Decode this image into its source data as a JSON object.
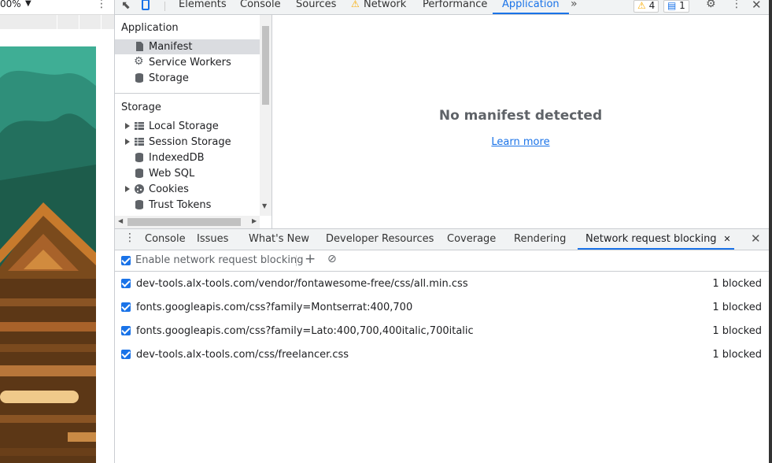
{
  "viewport": {
    "zoom_label": "00%"
  },
  "toolbar": {
    "tabs": [
      "Elements",
      "Console",
      "Sources",
      "Network",
      "Performance",
      "Application"
    ],
    "active_tab": "Application",
    "warnings_count": "4",
    "messages_count": "1"
  },
  "sidebar": {
    "application_heading": "Application",
    "application_items": [
      "Manifest",
      "Service Workers",
      "Storage"
    ],
    "storage_heading": "Storage",
    "storage_items": [
      "Local Storage",
      "Session Storage",
      "IndexedDB",
      "Web SQL",
      "Cookies",
      "Trust Tokens"
    ]
  },
  "main": {
    "title": "No manifest detected",
    "link": "Learn more"
  },
  "drawer": {
    "tabs": [
      "Console",
      "Issues",
      "What's New",
      "Developer Resources",
      "Coverage",
      "Rendering",
      "Network request blocking"
    ],
    "active_tab": "Network request blocking",
    "enable_label": "Enable network request blocking",
    "patterns": [
      {
        "url": "dev-tools.alx-tools.com/vendor/fontawesome-free/css/all.min.css",
        "status": "1 blocked"
      },
      {
        "url": "fonts.googleapis.com/css?family=Montserrat:400,700",
        "status": "1 blocked"
      },
      {
        "url": "fonts.googleapis.com/css?family=Lato:400,700,400italic,700italic",
        "status": "1 blocked"
      },
      {
        "url": "dev-tools.alx-tools.com/css/freelancer.css",
        "status": "1 blocked"
      }
    ]
  },
  "colors": {
    "accent": "#1a73e8",
    "warning": "#f9ab00",
    "toolbar_bg": "#f1f3f4"
  }
}
